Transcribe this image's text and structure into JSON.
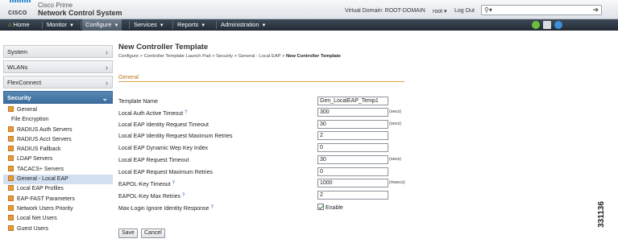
{
  "header": {
    "brand": "CISCO",
    "product_line": "Cisco Prime",
    "product": "Network Control System",
    "virtual_domain": "Virtual Domain: ROOT-DOMAIN",
    "user": "root",
    "logout": "Log Out"
  },
  "nav": {
    "items": [
      {
        "label": "Home",
        "has_dropdown": false
      },
      {
        "label": "Monitor",
        "has_dropdown": true
      },
      {
        "label": "Configure",
        "has_dropdown": true,
        "active": true
      },
      {
        "label": "Services",
        "has_dropdown": true
      },
      {
        "label": "Reports",
        "has_dropdown": true
      },
      {
        "label": "Administration",
        "has_dropdown": true
      }
    ]
  },
  "sidebar": {
    "groups": [
      "System",
      "WLANs",
      "FlexConnect"
    ],
    "security": {
      "label": "Security",
      "items": [
        "General",
        "File Encryption",
        "RADIUS Auth Servers",
        "RADIUS Acct Servers",
        "RADIUS Fallback",
        "LDAP Servers",
        "TACACS+ Servers",
        "General - Local EAP",
        "Local EAP Profiles",
        "EAP-FAST Parameters",
        "Network Users Priority",
        "Local Net Users",
        "Guest Users"
      ],
      "selected": "General - Local EAP"
    }
  },
  "page": {
    "title": "New Controller Template",
    "breadcrumb": [
      "Configure",
      "Controller Template Launch Pad",
      "Security",
      "General - Local EAP",
      "New Controller Template"
    ],
    "section": "General",
    "fields": [
      {
        "label": "Template Name",
        "value": "Gen_LocalEAP_Temp1",
        "unit": "",
        "help": false
      },
      {
        "label": "Local Auth Active Timeout",
        "value": "300",
        "unit": "(secs)",
        "help": true
      },
      {
        "label": "Local EAP Identity Request Timeout",
        "value": "30",
        "unit": "(secs)",
        "help": false
      },
      {
        "label": "Local EAP Identity Request Maximum Retries",
        "value": "2",
        "unit": "",
        "help": false
      },
      {
        "label": "Local EAP Dynamic Wep Key Index",
        "value": "0",
        "unit": "",
        "help": false
      },
      {
        "label": "Local EAP Request Timeout",
        "value": "30",
        "unit": "(secs)",
        "help": false
      },
      {
        "label": "Local EAP Request Maximum Retries",
        "value": "0",
        "unit": "",
        "help": false
      },
      {
        "label": "EAPOL-Key Timeout",
        "value": "1000",
        "unit": "(msecs)",
        "help": true
      },
      {
        "label": "EAPOL-Key Max Retries",
        "value": "2",
        "unit": "",
        "help": true
      }
    ],
    "max_login": {
      "label": "Max-Login Ignore Identity Response",
      "checkbox_label": "Enable",
      "checked": true,
      "help": true
    },
    "buttons": {
      "save": "Save",
      "cancel": "Cancel"
    }
  },
  "figure_number": "331136",
  "colors": {
    "nav_bg": "#2c3641",
    "security_header": "#4a7bab",
    "section_accent": "#b8741a"
  }
}
